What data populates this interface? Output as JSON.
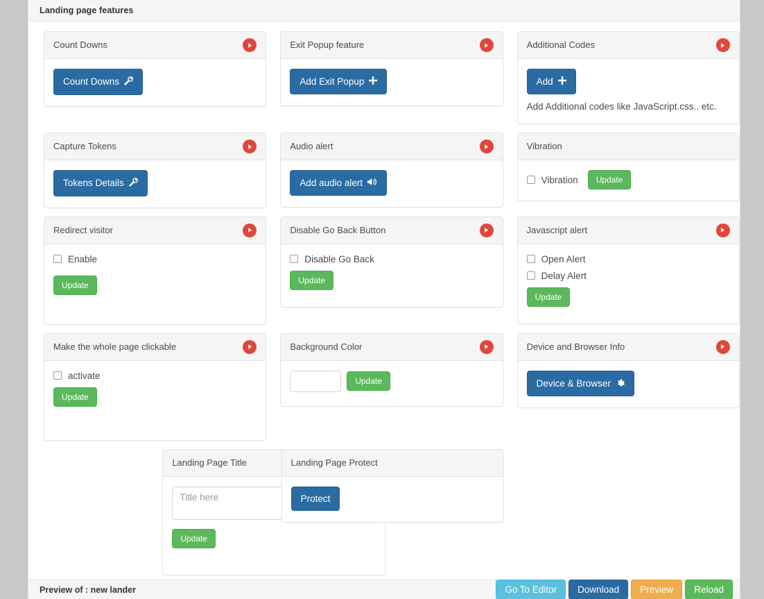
{
  "panel": {
    "title": "Landing page features"
  },
  "icons": {
    "play": "play-circle-icon",
    "wrench": "wrench-icon",
    "plus": "plus-icon",
    "volume": "volume-up-icon",
    "gear": "gear-icon"
  },
  "colors": {
    "play_icon": "#e0473b",
    "primary": "#2a6ba3",
    "success": "#5cb85c",
    "info": "#5bc0de",
    "warning": "#f0ad4e",
    "page_bg": "#c8c8c8",
    "card_header_bg": "#f5f5f5"
  },
  "cards": {
    "count_downs": {
      "title": "Count Downs",
      "has_play": true,
      "button": "Count Downs"
    },
    "exit_popup": {
      "title": "Exit Popup feature",
      "has_play": true,
      "button": "Add Exit Popup"
    },
    "additional_codes": {
      "title": "Additional Codes",
      "has_play": true,
      "button": "Add",
      "hint": "Add Additional codes like JavaScript.css.. etc."
    },
    "capture_tokens": {
      "title": "Capture Tokens",
      "has_play": true,
      "button": "Tokens Details"
    },
    "audio_alert": {
      "title": "Audio alert",
      "has_play": true,
      "button": "Add audio alert"
    },
    "vibration": {
      "title": "Vibration",
      "has_play": false,
      "checkbox_label": "Vibration",
      "checkbox_checked": false,
      "button": "Update"
    },
    "redirect_visitor": {
      "title": "Redirect visitor",
      "has_play": true,
      "checkbox_label": "Enable",
      "checkbox_checked": false,
      "button": "Update"
    },
    "disable_go_back": {
      "title": "Disable Go Back Button",
      "has_play": true,
      "checkbox_label": "Disable Go Back",
      "checkbox_checked": false,
      "button": "Update"
    },
    "javascript_alert": {
      "title": "Javascript alert",
      "has_play": true,
      "checkbox_open_label": "Open Alert",
      "checkbox_open_checked": false,
      "checkbox_delay_label": "Delay Alert",
      "checkbox_delay_checked": false,
      "button": "Update"
    },
    "whole_page_clickable": {
      "title": "Make the whole page clickable",
      "has_play": true,
      "checkbox_label": "activate",
      "checkbox_checked": false,
      "button": "Update"
    },
    "background_color": {
      "title": "Background Color",
      "has_play": true,
      "input_value": "",
      "input_placeholder": "",
      "button": "Update"
    },
    "device_browser": {
      "title": "Device and Browser Info",
      "has_play": true,
      "button": "Device & Browser"
    },
    "landing_page_title": {
      "title": "Landing Page Title",
      "has_play": true,
      "textarea_value": "",
      "textarea_placeholder": "Title here",
      "button": "Update"
    },
    "landing_page_protect": {
      "title": "Landing Page Protect",
      "has_play": false,
      "button": "Protect"
    }
  },
  "preview_bar": {
    "title": "Preview of : new lander",
    "buttons": {
      "editor": "Go To Editor",
      "download": "Download",
      "preview": "Preview",
      "reload": "Reload"
    }
  }
}
